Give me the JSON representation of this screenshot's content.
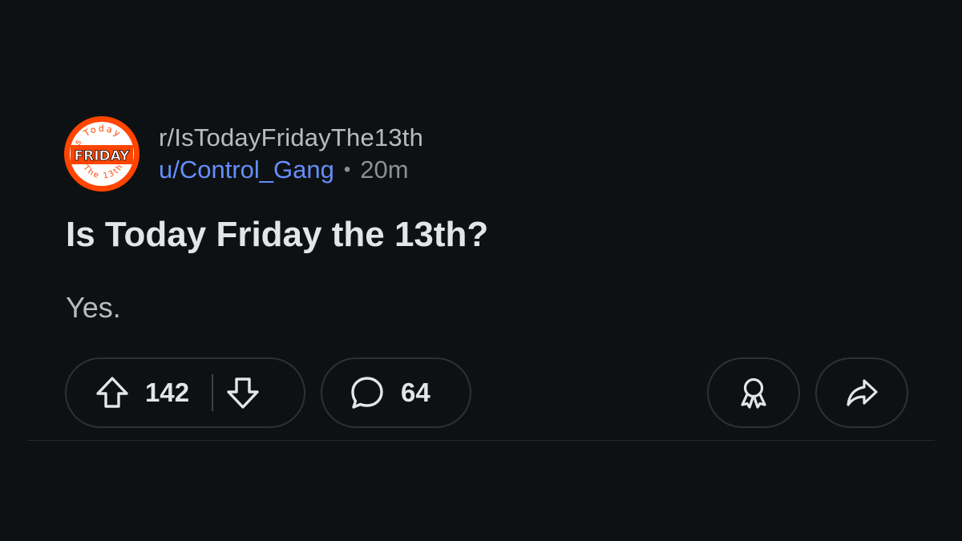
{
  "post": {
    "subreddit": "r/IsTodayFridayThe13th",
    "username": "u/Control_Gang",
    "separator": "•",
    "age": "20m",
    "title": "Is Today Friday the 13th?",
    "body": "Yes.",
    "avatar": {
      "top_text": "Is Today",
      "center_text": "FRIDAY",
      "bottom_text": "The 13th?",
      "color": "#ff4500"
    }
  },
  "actions": {
    "vote_count": "142",
    "comment_count": "64",
    "upvote_icon": "upvote-arrow-icon",
    "downvote_icon": "downvote-arrow-icon",
    "comment_icon": "comment-bubble-icon",
    "award_icon": "award-ribbon-icon",
    "share_icon": "share-arrow-icon"
  },
  "colors": {
    "background": "#0e1113",
    "username": "#648efc",
    "muted": "#8a9094",
    "pill_border": "#2a3236"
  }
}
